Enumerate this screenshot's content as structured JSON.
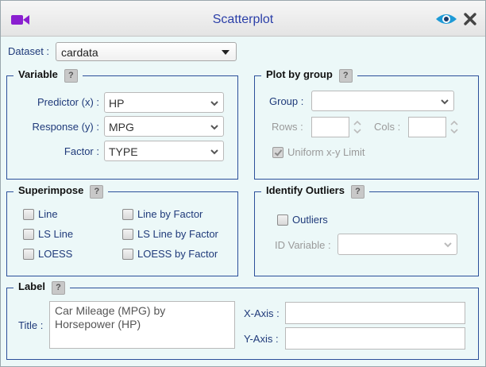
{
  "window": {
    "title": "Scatterplot"
  },
  "dataset": {
    "label": "Dataset :",
    "value": "cardata"
  },
  "variable": {
    "legend": "Variable",
    "help": "?",
    "predictor_label": "Predictor (x) :",
    "predictor_value": "HP",
    "response_label": "Response (y) :",
    "response_value": "MPG",
    "factor_label": "Factor :",
    "factor_value": "TYPE"
  },
  "plot_by_group": {
    "legend": "Plot by group",
    "help": "?",
    "group_label": "Group :",
    "group_value": "",
    "rows_label": "Rows :",
    "rows_value": "",
    "cols_label": "Cols :",
    "cols_value": "",
    "uniform_label": "Uniform x-y Limit",
    "uniform_checked": true
  },
  "superimpose": {
    "legend": "Superimpose",
    "help": "?",
    "options": [
      "Line",
      "LS Line",
      "LOESS",
      "Line by Factor",
      "LS Line by Factor",
      "LOESS by Factor"
    ]
  },
  "identify_outliers": {
    "legend": "Identify Outliers",
    "help": "?",
    "outliers_label": "Outliers",
    "id_variable_label": "ID Variable :",
    "id_variable_value": ""
  },
  "label": {
    "legend": "Label",
    "help": "?",
    "title_label": "Title :",
    "title_value": "Car Mileage (MPG) by\nHorsepower (HP)",
    "xaxis_label": "X-Axis :",
    "xaxis_value": "",
    "yaxis_label": "Y-Axis :",
    "yaxis_value": ""
  },
  "colors": {
    "window_bg": "#ecf8f8",
    "label_text": "#1f3a7a",
    "group_border": "#2b4f9a",
    "camera_icon": "#8a1fd0",
    "eye_icon": "#1e9ad6"
  },
  "icons": {
    "camera": "video-camera-icon",
    "eye": "eye-icon",
    "close": "close-icon"
  }
}
